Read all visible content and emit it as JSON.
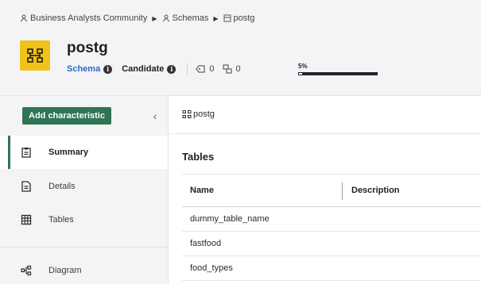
{
  "breadcrumb": {
    "community": "Business Analysts Community",
    "schemas": "Schemas",
    "current": "postg"
  },
  "asset": {
    "title": "postg",
    "type": "Schema",
    "status": "Candidate",
    "tag_count": "0",
    "relation_count": "0",
    "completeness_label": "5%",
    "completeness_value": 0.05,
    "icon_color": "#f1c21b"
  },
  "sidebar": {
    "add_button": "Add characteristic",
    "collapse_icon": "chevron-left-icon",
    "items": [
      {
        "label": "Summary",
        "icon": "clipboard-icon",
        "active": true
      },
      {
        "label": "Details",
        "icon": "document-icon",
        "active": false
      },
      {
        "label": "Tables",
        "icon": "table-icon",
        "active": false
      },
      {
        "label": "Diagram",
        "icon": "diagram-icon",
        "active": false
      }
    ]
  },
  "main": {
    "asset_name": "postg",
    "section_title": "Tables",
    "columns": [
      "Name",
      "Description"
    ],
    "rows": [
      "dummy_table_name",
      "fastfood",
      "food_types"
    ]
  },
  "colors": {
    "accent_green": "#2f7553",
    "link_blue": "#2c6ac7",
    "header_bg": "#f4f4f6"
  }
}
